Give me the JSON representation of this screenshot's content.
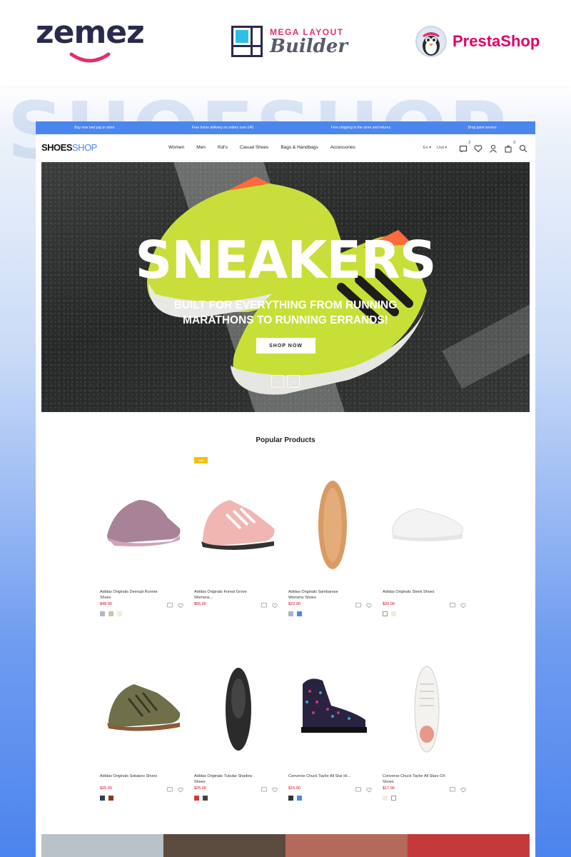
{
  "promo": {
    "zemes_logo": "zemez",
    "builder_line1": "MEGA LAYOUT",
    "builder_line2": "Builder",
    "presta_text": "PrestaShop",
    "ghost_text": "SHOESHOP"
  },
  "infobar": [
    "Buy now and pay in store",
    "Free home delivery on orders over £40",
    "Free shipping to the store and returns",
    "Drop point service"
  ],
  "store": {
    "brand_bold": "SHOES",
    "brand_light": "SHOP",
    "menu": [
      "Women",
      "Men",
      "Kid's",
      "Casual Shoes",
      "Bags & Handbags",
      "Accessories"
    ],
    "lang": "En ▾",
    "currency": "Usd ▾",
    "compare_count": "2",
    "cart_count": "0"
  },
  "hero": {
    "title": "SNEAKERS",
    "subtitle": "BUILT FOR EVERYTHING FROM RUNNING MARATHONS TO RUNNING ERRANDS!",
    "button": "SHOP NOW",
    "prev": "←",
    "next": "→"
  },
  "section_title": "Popular Products",
  "products": [
    {
      "name": "Adidas Originals Deerupt Runner Shoes",
      "price": "$48.00",
      "badge": "",
      "swatches": [
        "#b3b6c8",
        "#cfc3a8",
        "#f2efd6"
      ]
    },
    {
      "name": "Adidas Originals Forest Grove Womens...",
      "price": "$56.00",
      "badge": "sale",
      "swatches": []
    },
    {
      "name": "Adidas Originals Sambarose Womens Shoes",
      "price": "$22.00",
      "badge": "",
      "swatches": [
        "#aab4c8",
        "#4a86ee"
      ]
    },
    {
      "name": "Adidas Originals Sleek Shoes",
      "price": "$20.00",
      "badge": "",
      "swatches": [
        "#ffffff",
        "#f2ecd6"
      ]
    },
    {
      "name": "Adidas Originals Sobakov Shoes",
      "price": "$25.00",
      "badge": "",
      "swatches": [
        "#2f3f4f",
        "#8a3a10"
      ]
    },
    {
      "name": "Adidas Originals Tubular Shadow Shoes",
      "price": "$25.00",
      "badge": "",
      "swatches": [
        "#d63a3a",
        "#444444"
      ]
    },
    {
      "name": "Converse Chuck Taylor All Star Hi...",
      "price": "$15.00",
      "badge": "",
      "swatches": [
        "#333333",
        "#4a86ee"
      ]
    },
    {
      "name": "Converse Chuck Taylor All Stars OX Shoes",
      "price": "$17.00",
      "badge": "",
      "swatches": [
        "#f3efe0",
        "#ffffff"
      ]
    }
  ]
}
